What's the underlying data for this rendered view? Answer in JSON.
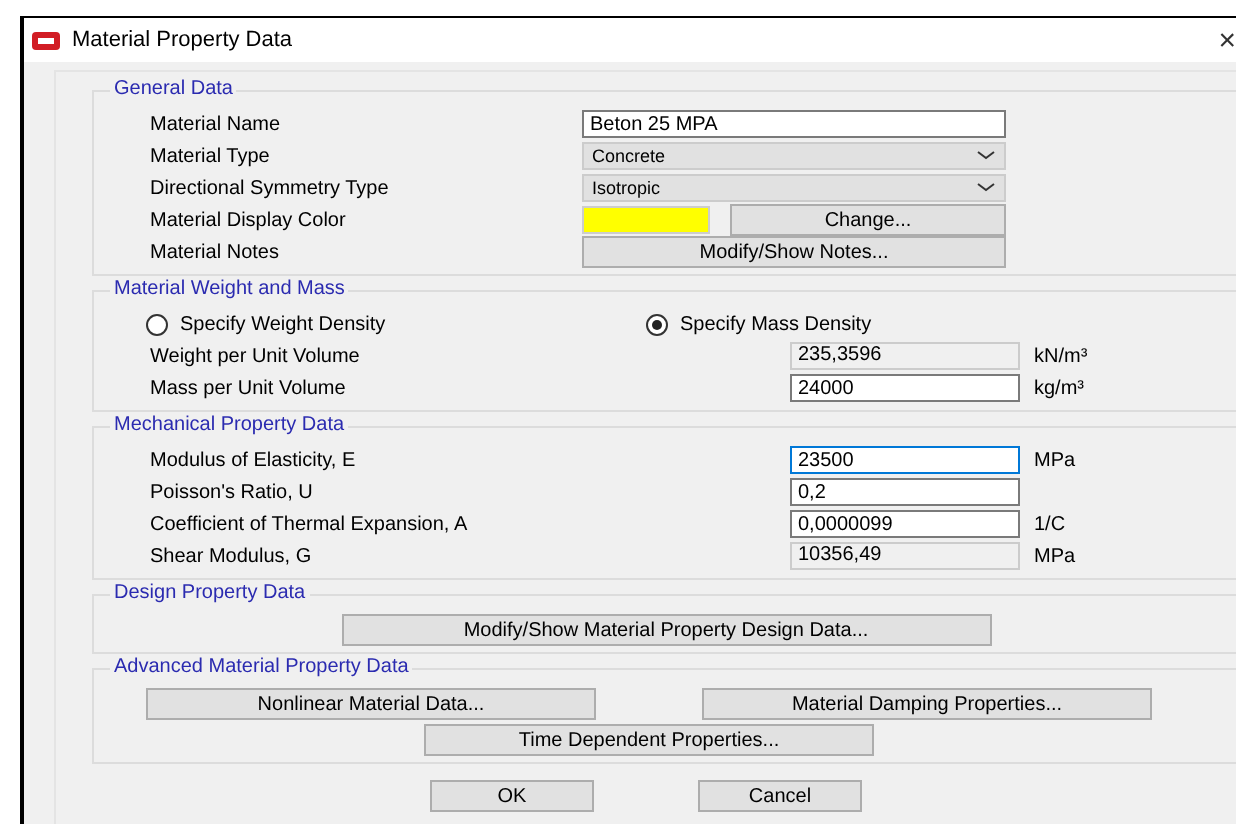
{
  "window": {
    "title": "Material Property Data",
    "close": "×"
  },
  "general": {
    "title": "General Data",
    "rows": [
      {
        "label": "Material Name",
        "kind": "text",
        "value": "Beton 25 MPA"
      },
      {
        "label": "Material Type",
        "kind": "dropdown",
        "value": "Concrete"
      },
      {
        "label": "Directional Symmetry Type",
        "kind": "dropdown",
        "value": "Isotropic"
      },
      {
        "label": "Material Display Color",
        "kind": "color",
        "color": "#ffff00",
        "button": "Change..."
      },
      {
        "label": "Material Notes",
        "kind": "button",
        "button": "Modify/Show Notes..."
      }
    ]
  },
  "weight": {
    "title": "Material Weight and Mass",
    "options": [
      {
        "label": "Specify Weight Density",
        "selected": false
      },
      {
        "label": "Specify Mass Density",
        "selected": true
      }
    ],
    "rows": [
      {
        "label": "Weight per Unit Volume",
        "value": "235,3596",
        "disabled": true,
        "focused": false,
        "unit": "kN/m³"
      },
      {
        "label": "Mass per Unit Volume",
        "value": "24000",
        "disabled": false,
        "focused": false,
        "unit": "kg/m³"
      }
    ]
  },
  "mechanical": {
    "title": "Mechanical Property Data",
    "rows": [
      {
        "label": "Modulus of Elasticity,  E",
        "value": "23500",
        "disabled": false,
        "focused": true,
        "unit": "MPa"
      },
      {
        "label": "Poisson's Ratio,  U",
        "value": "0,2",
        "disabled": false,
        "focused": false
      },
      {
        "label": "Coefficient of Thermal Expansion,  A",
        "value": "0,0000099",
        "disabled": false,
        "focused": false,
        "unit": "1/C"
      },
      {
        "label": "Shear Modulus,  G",
        "value": "10356,49",
        "disabled": true,
        "focused": false,
        "unit": "MPa"
      }
    ]
  },
  "design": {
    "title": "Design Property Data",
    "button": "Modify/Show Material Property Design Data..."
  },
  "advanced": {
    "title": "Advanced Material Property Data",
    "buttons": [
      "Nonlinear Material Data...",
      "Material Damping Properties...",
      "Time Dependent Properties..."
    ]
  },
  "footer": {
    "buttons": [
      "OK",
      "Cancel"
    ]
  }
}
